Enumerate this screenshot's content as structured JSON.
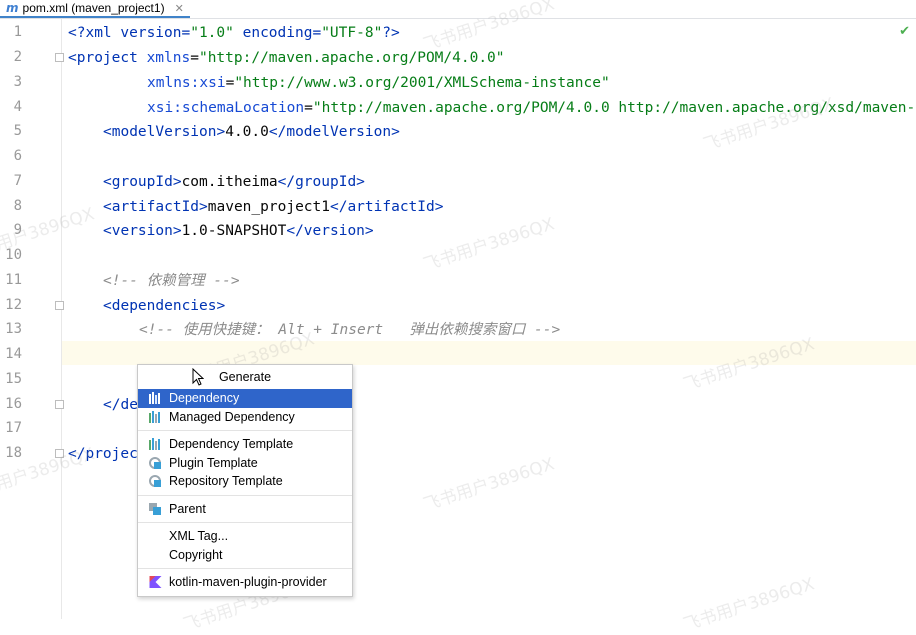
{
  "tab": {
    "icon": "maven-m-icon",
    "title": "pom.xml (maven_project1)"
  },
  "status": {
    "icon": "checkmark-icon"
  },
  "line_numbers": [
    "1",
    "2",
    "3",
    "4",
    "5",
    "6",
    "7",
    "8",
    "9",
    "10",
    "11",
    "12",
    "13",
    "14",
    "15",
    "16",
    "17",
    "18"
  ],
  "code": {
    "l1_a": "<?xml version=",
    "l1_b": "\"1.0\"",
    "l1_c": " encoding=",
    "l1_d": "\"UTF-8\"",
    "l1_e": "?>",
    "l2_a": "<project ",
    "l2_b": "xmlns",
    "l2_c": "=",
    "l2_d": "\"http://maven.apache.org/POM/4.0.0\"",
    "l3_a": "xmlns:xsi",
    "l3_b": "=",
    "l3_c": "\"http://www.w3.org/2001/XMLSchema-instance\"",
    "l4_a": "xsi:schemaLocation",
    "l4_b": "=",
    "l4_c": "\"http://maven.apache.org/POM/4.0.0 http://maven.apache.org/xsd/maven-",
    "l5_a": "<modelVersion>",
    "l5_b": "4.0.0",
    "l5_c": "</modelVersion>",
    "l7_a": "<groupId>",
    "l7_b": "com.itheima",
    "l7_c": "</groupId>",
    "l8_a": "<artifactId>",
    "l8_b": "maven_project1",
    "l8_c": "</artifactId>",
    "l9_a": "<version>",
    "l9_b": "1.0-SNAPSHOT",
    "l9_c": "</version>",
    "l11": "<!-- 依赖管理 -->",
    "l12": "<dependencies>",
    "l13": "<!-- 使用快捷键： Alt + Insert   弹出依赖搜索窗口 -->",
    "l16": "</de",
    "l18": "</projec"
  },
  "popup": {
    "header": "Generate",
    "items": [
      {
        "label": "Dependency",
        "icon": "maven-library-icon",
        "selected": true
      },
      {
        "label": "Managed Dependency",
        "icon": "maven-library-icon"
      },
      {
        "label": "Dependency Template",
        "icon": "maven-library-icon"
      },
      {
        "label": "Plugin Template",
        "icon": "maven-plugin-icon"
      },
      {
        "label": "Repository Template",
        "icon": "maven-plugin-icon"
      },
      {
        "label": "Parent",
        "icon": "maven-parent-icon"
      },
      {
        "label": "XML Tag...",
        "icon": ""
      },
      {
        "label": "Copyright",
        "icon": ""
      },
      {
        "label": "kotlin-maven-plugin-provider",
        "icon": "kotlin-icon"
      }
    ]
  },
  "watermark": "飞书用户3896QX",
  "colors": {
    "selection": "#2f65ca",
    "tag": "#0033b3",
    "string": "#067d17",
    "comment": "#8c8c8c",
    "caret_line": "#fefbeb"
  }
}
